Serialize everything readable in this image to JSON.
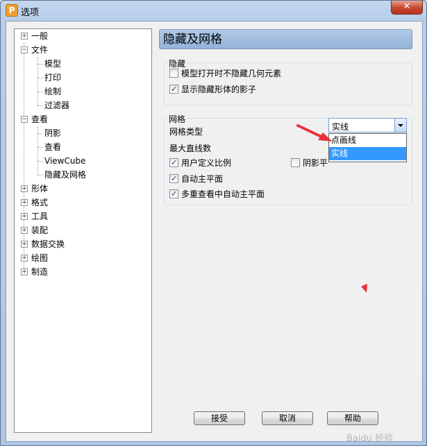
{
  "window": {
    "title": "选项",
    "app_icon_letter": "P",
    "close_glyph": "✕"
  },
  "tree": {
    "items": [
      {
        "label": "一般",
        "level": 0,
        "expander": "+"
      },
      {
        "label": "文件",
        "level": 0,
        "expander": "−"
      },
      {
        "label": "模型",
        "level": 1
      },
      {
        "label": "打印",
        "level": 1
      },
      {
        "label": "绘制",
        "level": 1
      },
      {
        "label": "过滤器",
        "level": 1
      },
      {
        "label": "查看",
        "level": 0,
        "expander": "−"
      },
      {
        "label": "阴影",
        "level": 1
      },
      {
        "label": "查看",
        "level": 1
      },
      {
        "label": "ViewCube",
        "level": 1
      },
      {
        "label": "隐藏及网格",
        "level": 1,
        "selected": true
      },
      {
        "label": "形体",
        "level": 0,
        "expander": "+"
      },
      {
        "label": "格式",
        "level": 0,
        "expander": "+"
      },
      {
        "label": "工具",
        "level": 0,
        "expander": "+"
      },
      {
        "label": "装配",
        "level": 0,
        "expander": "+"
      },
      {
        "label": "数据交换",
        "level": 0,
        "expander": "+"
      },
      {
        "label": "绘图",
        "level": 0,
        "expander": "+"
      },
      {
        "label": "制造",
        "level": 0,
        "expander": "+"
      }
    ]
  },
  "panel": {
    "title": "隐藏及网格",
    "hide_group": {
      "label": "隐藏",
      "checkboxes": [
        {
          "label": "模型打开时不隐藏几何元素",
          "checked": false
        },
        {
          "label": "显示隐藏形体的影子",
          "checked": true
        }
      ]
    },
    "grid_group": {
      "label": "网格",
      "grid_type_label": "网格类型",
      "max_lines_label": "最大直线数",
      "combo": {
        "value": "实线",
        "options": [
          "点画线",
          "实线"
        ],
        "selected_option": "实线"
      },
      "checkboxes": [
        {
          "label": "用户定义比例",
          "checked": true
        },
        {
          "label": "阴影平",
          "checked": false
        },
        {
          "label": "自动主平面",
          "checked": true
        },
        {
          "label": "多重查看中自动主平面",
          "checked": true
        }
      ]
    }
  },
  "buttons": {
    "ok": "接受",
    "cancel": "取消",
    "help": "帮助"
  },
  "annotation": {
    "arrow_color": "#e8333a"
  },
  "watermark": "Baidu 经验",
  "colors": {
    "selection": "#3399ff",
    "header_bg": "#9fbde0"
  }
}
